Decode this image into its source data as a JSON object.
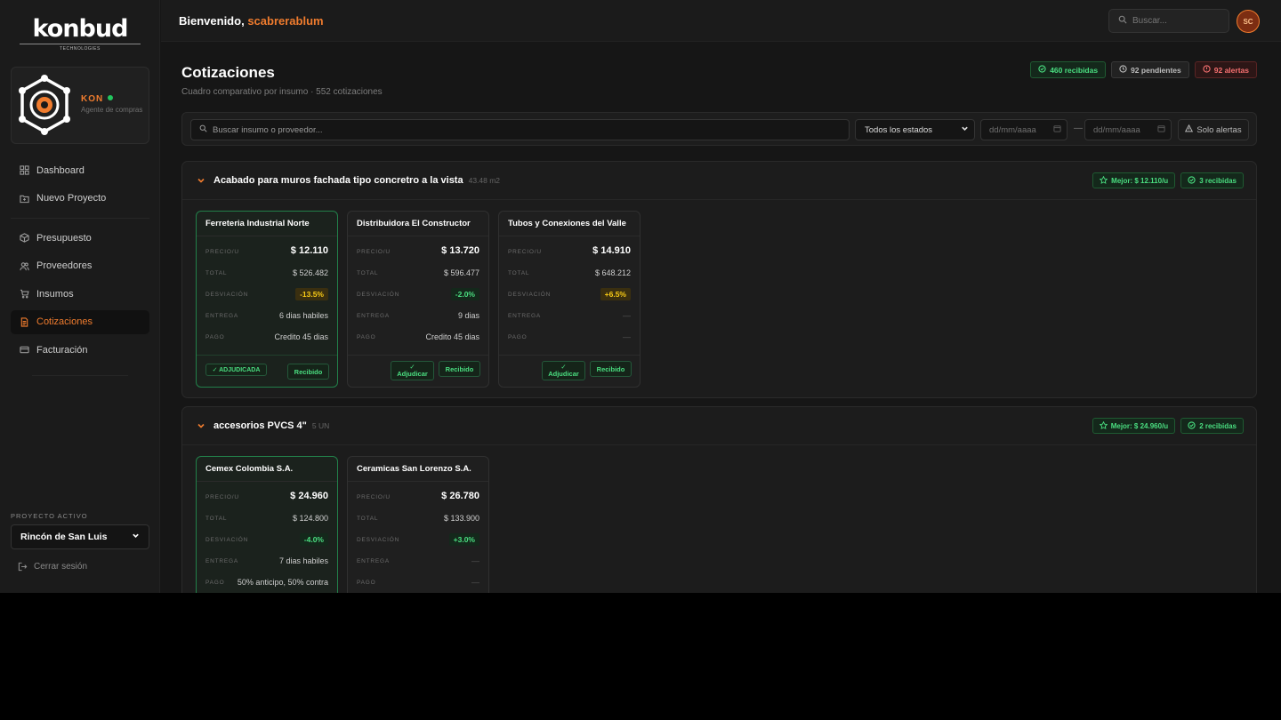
{
  "brand": {
    "name": "konbud",
    "tagline": "TECHNOLOGIES"
  },
  "agent": {
    "name": "KON",
    "role": "Agente de compras"
  },
  "nav": {
    "dashboard": "Dashboard",
    "nuevo": "Nuevo Proyecto",
    "presupuesto": "Presupuesto",
    "proveedores": "Proveedores",
    "insumos": "Insumos",
    "cotizaciones": "Cotizaciones",
    "facturacion": "Facturación"
  },
  "project": {
    "label": "PROYECTO ACTIVO",
    "selected": "Rincón de San Luis"
  },
  "logout": "Cerrar sesión",
  "header": {
    "welcome": "Bienvenido,",
    "username": "scabrerablum",
    "search_placeholder": "Buscar...",
    "avatar_initials": "SC"
  },
  "page": {
    "title": "Cotizaciones",
    "subtitle": "Cuadro comparativo por insumo · 552 cotizaciones",
    "badges": {
      "received": "460 recibidas",
      "pending": "92 pendientes",
      "alerts": "92 alertas"
    }
  },
  "filters": {
    "search_placeholder": "Buscar insumo o proveedor...",
    "status": "Todos los estados",
    "date_from": "dd/mm/aaaa",
    "date_to": "dd/mm/aaaa",
    "dash": "—",
    "alerts_only": "Solo alertas"
  },
  "labels": {
    "price": "PRECIO/U",
    "total": "TOTAL",
    "deviation": "DESVIACIÓN",
    "delivery": "ENTREGA",
    "payment": "PAGO"
  },
  "groups": [
    {
      "title": "Acabado para muros fachada tipo concretro a la vista",
      "qty": "43.48 m2",
      "best": "Mejor: $ 12.110/u",
      "received": "3 recibidas",
      "quotes": [
        {
          "supplier": "Ferreteria Industrial Norte",
          "price": "$ 12.110",
          "total": "$ 526.482",
          "deviation": "-13.5%",
          "delivery": "6 dias habiles",
          "payment": "Credito 45 dias",
          "status_left": "✓ ADJUDICADA",
          "status_right": "Recibido"
        },
        {
          "supplier": "Distribuidora El Constructor",
          "price": "$ 13.720",
          "total": "$ 596.477",
          "deviation": "-2.0%",
          "delivery": "9 dias",
          "payment": "Credito 45 dias",
          "action": "Adjudicar",
          "status_right": "Recibido"
        },
        {
          "supplier": "Tubos y Conexiones del Valle",
          "price": "$ 14.910",
          "total": "$ 648.212",
          "deviation": "+6.5%",
          "delivery": "—",
          "payment": "—",
          "action": "Adjudicar",
          "status_right": "Recibido"
        }
      ]
    },
    {
      "title": "accesorios PVCS 4\"",
      "qty": "5 UN",
      "best": "Mejor: $ 24.960/u",
      "received": "2 recibidas",
      "quotes": [
        {
          "supplier": "Cemex Colombia S.A.",
          "price": "$ 24.960",
          "total": "$ 124.800",
          "deviation": "-4.0%",
          "delivery": "7 dias habiles",
          "payment": "50% anticipo, 50% contra"
        },
        {
          "supplier": "Ceramicas San Lorenzo S.A.",
          "price": "$ 26.780",
          "total": "$ 133.900",
          "deviation": "+3.0%",
          "delivery": "—",
          "payment": "—"
        }
      ]
    }
  ],
  "icons": {
    "check": "check-icon",
    "star": "star-icon",
    "clock": "clock-icon",
    "alert": "alert-icon"
  },
  "colors": {
    "accent": "#f07c2e",
    "success": "#4ade80",
    "danger": "#f87171",
    "warning": "#facc15"
  }
}
